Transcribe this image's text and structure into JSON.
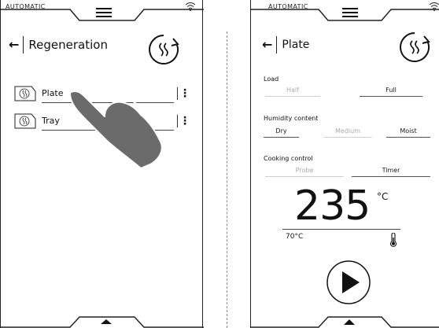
{
  "left_screen": {
    "status_label": "AUTOMATIC",
    "title": "Regeneration",
    "title_icon": "steam-regeneration-icon",
    "items": [
      {
        "label": "Plate",
        "icon": "plate-badge-icon"
      },
      {
        "label": "Tray",
        "icon": "tray-badge-icon"
      }
    ],
    "overlay_icon": "pointing-hand-icon"
  },
  "right_screen": {
    "status_label": "AUTOMATIC",
    "title": "Plate",
    "title_icon": "steam-regeneration-icon",
    "load": {
      "label": "Load",
      "options": [
        "Half",
        "Full"
      ],
      "selected": "Full"
    },
    "humidity": {
      "label": "Humidity content",
      "options": [
        "Dry",
        "Medium",
        "Moist"
      ],
      "selected": [
        "Dry",
        "Moist"
      ]
    },
    "cooking_control": {
      "label": "Cooking control",
      "options": [
        "Probe",
        "Timer"
      ],
      "selected": "Timer"
    },
    "temperature": "235",
    "temperature_unit": "°C",
    "probe_temperature": "70°C",
    "play_icon": "play-icon"
  },
  "colors": {
    "ink": "#1a1a1a",
    "dim": "#a9a9a9",
    "hand": "#6b6b6b"
  }
}
